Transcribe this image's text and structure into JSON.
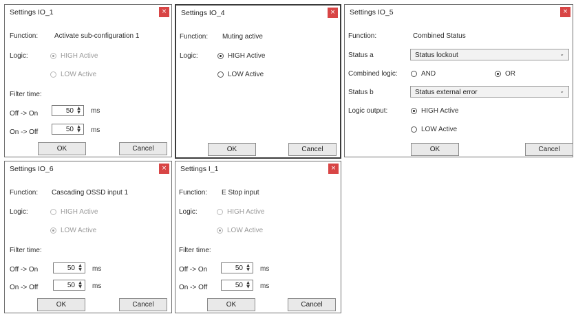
{
  "labels": {
    "function": "Function:",
    "logic": "Logic:",
    "filter_time": "Filter time:",
    "off_on": "Off -> On",
    "on_off": "On -> Off",
    "ms": "ms",
    "ok": "OK",
    "cancel": "Cancel",
    "status_a": "Status a",
    "combined_logic": "Combined logic:",
    "status_b": "Status b",
    "logic_output": "Logic output:",
    "high_active": "HIGH Active",
    "low_active": "LOW Active",
    "and": "AND",
    "or": "OR"
  },
  "icons": {
    "close": "close-icon",
    "spin": "spin-arrows-icon",
    "dropdown": "chevron-down-icon"
  },
  "colors": {
    "close_button": "#d84545"
  },
  "dialogs": {
    "io1": {
      "title": "Settings IO_1",
      "close": "×",
      "function": "Activate sub-configuration 1",
      "logic_selected": "HIGH Active",
      "off_on_value": "50",
      "on_off_value": "50"
    },
    "io4": {
      "title": "Settings IO_4",
      "close": "×",
      "function": "Muting active",
      "logic_selected": "HIGH Active"
    },
    "io5": {
      "title": "Settings IO_5",
      "close": "×",
      "function": "Combined Status",
      "status_a": "Status lockout",
      "combined_logic_selected": "OR",
      "status_b": "Status external error",
      "logic_output_selected": "HIGH Active"
    },
    "io6": {
      "title": "Settings IO_6",
      "close": "×",
      "function": "Cascading OSSD input 1",
      "logic_selected": "LOW Active",
      "off_on_value": "50",
      "on_off_value": "50"
    },
    "i1": {
      "title": "Settings I_1",
      "close": "×",
      "function": "E Stop input",
      "logic_selected": "LOW Active",
      "off_on_value": "50",
      "on_off_value": "50"
    }
  }
}
